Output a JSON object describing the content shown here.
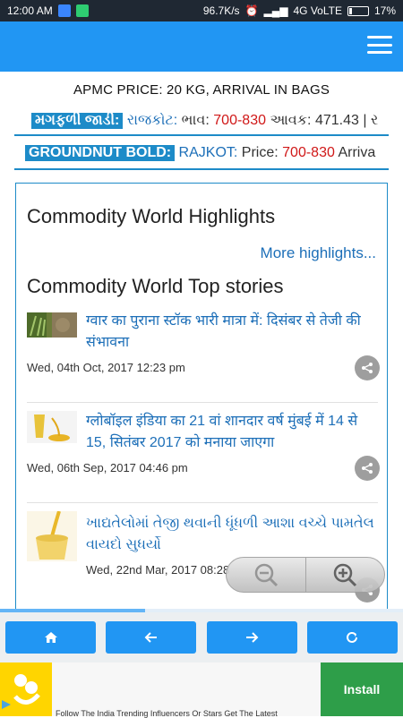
{
  "status_bar": {
    "time": "12:00 AM",
    "speed": "96.7K/s",
    "network": "4G VoLTE",
    "battery": "17%",
    "battery_level": 0.17
  },
  "header": {
    "apmc_title": "APMC PRICE: 20 KG, ARRIVAL IN BAGS"
  },
  "tickers": [
    {
      "tag": "મગફળી જાડી:",
      "city": "રાજકોટ:",
      "price_label": "ભાવ:",
      "price": "700-830",
      "arrival_label": "આવક:",
      "arrival": "471.43 | ર"
    },
    {
      "tag": "GROUNDNUT BOLD:",
      "city": "RAJKOT:",
      "price_label": "Price:",
      "price": "700-830",
      "arrival_label": "Arriva"
    }
  ],
  "highlights": {
    "title": "Commodity World Highlights",
    "more_link": "More highlights...",
    "top_stories_title": "Commodity World Top stories"
  },
  "stories": [
    {
      "headline": "ग्वार का पुराना स्टॉक भारी मात्रा में: दिसंबर से तेजी की संभावना",
      "date": "Wed, 04th Oct, 2017 12:23 pm"
    },
    {
      "headline": "ग्लोबॉइल इंडिया का 21 वां शानदार वर्ष मुंबई में 14 से 15, सितंबर 2017 को मनाया जाएगा",
      "date": "Wed, 06th Sep, 2017 04:46 pm"
    },
    {
      "headline": "ખાદ્યતેલોમાં તેજી થવાની ધૂંધળી આશા વચ્ચે પામતેલ વાયદો સુધર્યો",
      "date": "Wed, 22nd Mar, 2017 08:28"
    }
  ],
  "progress": {
    "level": 0.36
  },
  "ad": {
    "text": "Follow The India Trending Influencers Or Stars Get The Latest",
    "install_label": "Install"
  },
  "colors": {
    "app_bar": "#2196f3",
    "accent": "#1d8bc8",
    "link": "#1d6fb8",
    "price": "#d01818",
    "install": "#2e9e49"
  }
}
